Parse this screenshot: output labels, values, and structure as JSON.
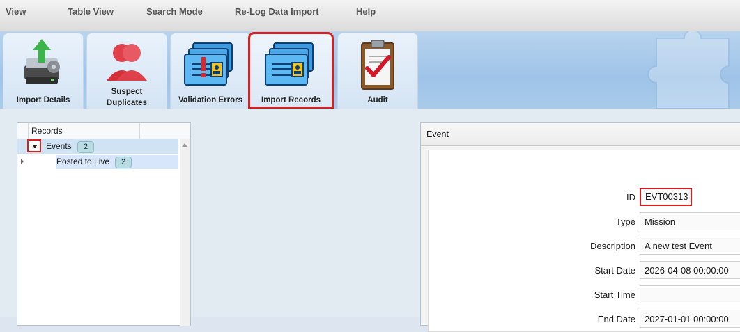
{
  "menu": [
    "View",
    "Table View",
    "Search Mode",
    "Re-Log Data Import",
    "Help"
  ],
  "tabs": [
    {
      "label": "Import Details",
      "icon": "server-upload-icon"
    },
    {
      "label": "Suspect Duplicates",
      "label_line1": "Suspect",
      "label_line2": "Duplicates",
      "icon": "duplicate-people-icon"
    },
    {
      "label": "Validation Errors",
      "icon": "folder-error-icon"
    },
    {
      "label": "Import Records",
      "icon": "folder-records-icon",
      "selected": true
    },
    {
      "label": "Audit",
      "icon": "clipboard-check-icon"
    }
  ],
  "tree": {
    "header": "Records",
    "rows": [
      {
        "label": "Events",
        "count": "2",
        "expanded": true
      },
      {
        "label": "Posted to Live",
        "count": "2"
      }
    ]
  },
  "event": {
    "panel_title": "Event",
    "fields": [
      {
        "label": "ID",
        "value": "EVT00313"
      },
      {
        "label": "Type",
        "value": "Mission"
      },
      {
        "label": "Description",
        "value": "A new test Event"
      },
      {
        "label": "Start Date",
        "value": "2026-04-08 00:00:00"
      },
      {
        "label": "Start Time",
        "value": ""
      },
      {
        "label": "End Date",
        "value": "2027-01-01 00:00:00"
      }
    ]
  },
  "colors": {
    "highlight": "#d91e1e",
    "ribbon": "#a9cbeb",
    "badge": "#b9dce3"
  }
}
